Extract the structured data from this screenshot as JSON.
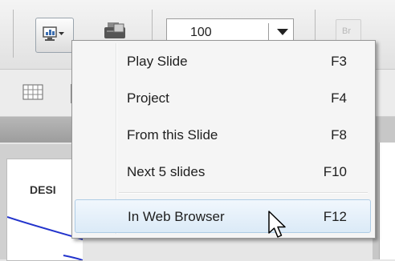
{
  "toolbar": {
    "zoom_value": "100",
    "br_label": "Br",
    "preview_icon": "preview-monitor-icon",
    "publish_icon": "publish-icon"
  },
  "workspace": {
    "canvas_label": "DESI"
  },
  "preview_menu": {
    "items": [
      {
        "label": "Play Slide",
        "shortcut": "F3"
      },
      {
        "label": "Project",
        "shortcut": "F4"
      },
      {
        "label": "From this Slide",
        "shortcut": "F8"
      },
      {
        "label": "Next 5 slides",
        "shortcut": "F10"
      },
      {
        "label": "In Web Browser",
        "shortcut": "F12",
        "highlighted": true
      }
    ]
  },
  "colors": {
    "menu_background": "#f5f5f5",
    "highlight_border": "#aecce6",
    "curve": "#2233cc"
  }
}
